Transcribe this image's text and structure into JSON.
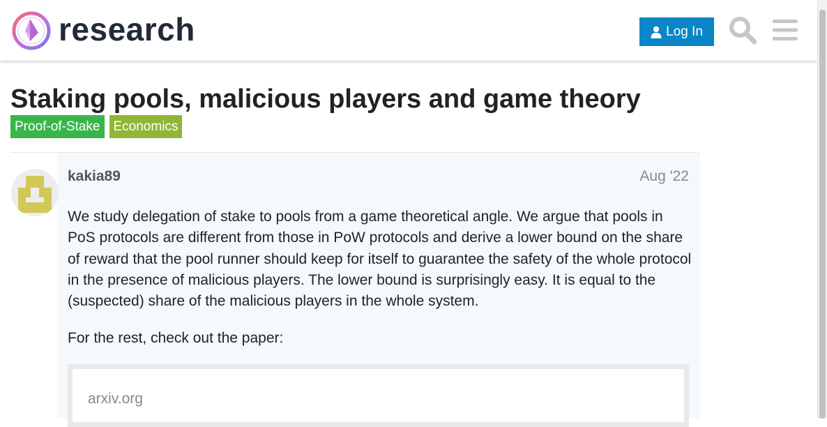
{
  "header": {
    "site_name": "research",
    "login_label": "Log In",
    "icons": {
      "login": "user-icon",
      "search": "search-icon",
      "menu": "hamburger-icon"
    },
    "accent_color": "#0a86c8"
  },
  "topic": {
    "title": "Staking pools, malicious players and game theory",
    "tags": [
      {
        "label": "Proof-of-Stake",
        "color": "#3ab54a"
      },
      {
        "label": "Economics",
        "color": "#92b536"
      }
    ]
  },
  "post": {
    "username": "kakia89",
    "date": "Aug '22",
    "paragraphs": [
      "We study delegation of stake to pools from a game theoretical angle. We argue that pools in PoS protocols are different from those in PoW protocols and derive a lower bound on the share of reward that the pool runner should keep for itself to guarantee the safety of the whole protocol in the presence of malicious players. The lower bound is surprisingly easy. It is equal to the (suspected) share of the malicious players in the whole system.",
      "For the rest, check out the paper:"
    ],
    "onebox": {
      "source": "arxiv.org"
    }
  }
}
